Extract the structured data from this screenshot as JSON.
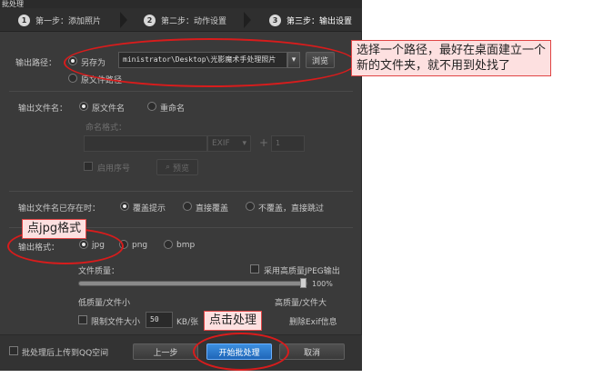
{
  "window": {
    "title": "批处理"
  },
  "steps": [
    {
      "num": "1",
      "label": "第一步：添加照片"
    },
    {
      "num": "2",
      "label": "第二步：动作设置"
    },
    {
      "num": "3",
      "label": "第三步：输出设置"
    }
  ],
  "output_path": {
    "label": "输出路径：",
    "save_as_label": "另存为",
    "path_value": "ministrator\\Desktop\\光影魔术手处理照片",
    "browse_label": "浏览",
    "original_path_label": "原文件路径"
  },
  "output_filename": {
    "label": "输出文件名：",
    "original_name_label": "原文件名",
    "rename_label": "重命名",
    "naming_format_label": "命名格式：",
    "exif_value": "EXIF",
    "plus": "+",
    "start_number": "1",
    "seq_label": "启用序号",
    "preview_label": "预览"
  },
  "exists": {
    "label": "输出文件名已存在时：",
    "options": [
      "覆盖提示",
      "直接覆盖",
      "不覆盖，直接跳过"
    ]
  },
  "format": {
    "label": "输出格式：",
    "options": [
      "jpg",
      "png",
      "bmp"
    ],
    "quality_label": "文件质量：",
    "high_quality_label": "采用高质量JPEG输出",
    "quality_value": "100%",
    "quality_percent": 100,
    "low_label": "低质量/文件小",
    "high_label": "高质量/文件大",
    "limit_label": "限制文件大小",
    "limit_value": "50",
    "limit_unit": "KB/张",
    "remove_exif_label": "删除Exif信息"
  },
  "bottom": {
    "upload_label": "批处理后上传到QQ空间",
    "prev_label": "上一步",
    "start_label": "开始批处理",
    "cancel_label": "取消"
  },
  "annotations": {
    "path_tip": "选择一个路径，最好在桌面建立一个\n新的文件夹，就不用到处找了",
    "jpg_tip": "点jpg格式",
    "process_tip": "点击处理"
  },
  "colors": {
    "dialog_bg": "#3a3a3a",
    "primary_button": "#2a78d0",
    "annotation_red": "#d81c1c",
    "callout_bg": "#fde0e0"
  }
}
